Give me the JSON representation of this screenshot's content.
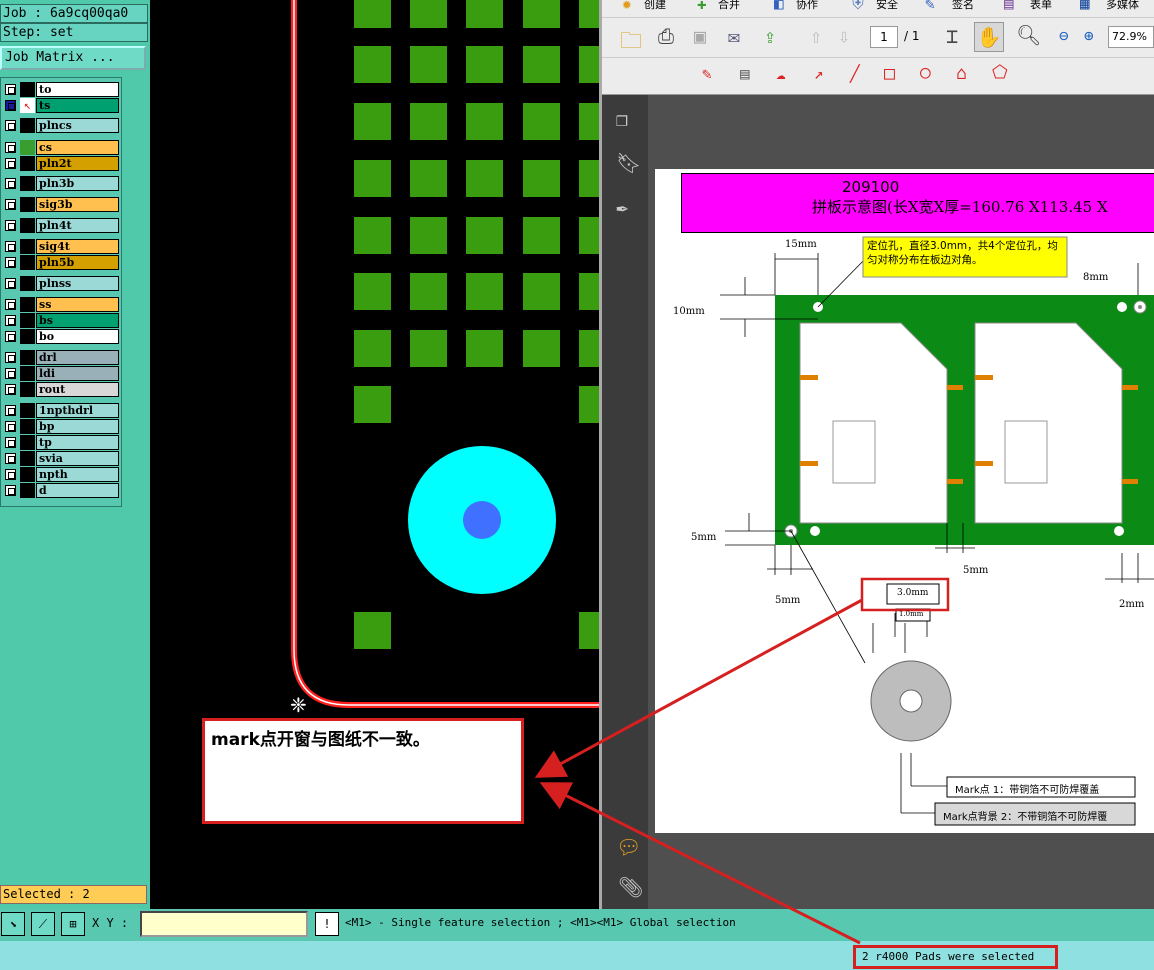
{
  "left_panel": {
    "job": "Job : 6a9cq00qa0",
    "step": "Step: set",
    "job_matrix_label": "Job Matrix ...",
    "layers": [
      {
        "name": "to",
        "color": "#ffffff"
      },
      {
        "name": "ts",
        "color": "#00a070"
      },
      {
        "name": "plncs",
        "color": "#9ad9d5"
      },
      {
        "name": "cs",
        "color": "#ffc050"
      },
      {
        "name": "pln2t",
        "color": "#d4a000"
      },
      {
        "name": "pln3b",
        "color": "#9ad9d5"
      },
      {
        "name": "sig3b",
        "color": "#ffc050"
      },
      {
        "name": "pln4t",
        "color": "#9ad9d5"
      },
      {
        "name": "sig4t",
        "color": "#ffc050"
      },
      {
        "name": "pln5b",
        "color": "#d4a000"
      },
      {
        "name": "plnss",
        "color": "#9ad9d5"
      },
      {
        "name": "ss",
        "color": "#ffc050"
      },
      {
        "name": "bs",
        "color": "#00a070"
      },
      {
        "name": "bo",
        "color": "#ffffff"
      },
      {
        "name": "drl",
        "color": "#9ab0b8"
      },
      {
        "name": "ldi",
        "color": "#9ab0b8"
      },
      {
        "name": "rout",
        "color": "#d8d8d8"
      },
      {
        "name": "1npthdrl",
        "color": "#9ad9d5"
      },
      {
        "name": "bp",
        "color": "#9ad9d5"
      },
      {
        "name": "tp",
        "color": "#9ad9d5"
      },
      {
        "name": "svia",
        "color": "#9ad9d5"
      },
      {
        "name": "npth",
        "color": "#9ad9d5"
      },
      {
        "name": "d",
        "color": "#9ad9d5"
      }
    ],
    "selected": "Selected : 2"
  },
  "canvas": {
    "annotation": "mark点开窗与图纸不一致。"
  },
  "bottom": {
    "xy_label": "X Y :",
    "warn_label": "!",
    "message": "<M1> - Single feature selection ; <M1><M1> Global selection",
    "status": "2 r4000 Pads were selected"
  },
  "pdf": {
    "toolbar_top": [
      "创建",
      "合并",
      "协作",
      "安全",
      "签名",
      "表单",
      "多媒体"
    ],
    "page_input": "1",
    "page_total": "/ 1",
    "zoom": "72.9%",
    "doc_title_line1": "209100",
    "doc_title_line2": "拼板示意图(长X宽X厚=160.76 X113.45 X",
    "callout_text": "定位孔，直径3.0mm，共4个定位孔，均匀对称分布在板边对角。",
    "dims": {
      "d15": "15mm",
      "d10": "10mm",
      "d8": "8mm",
      "d5a": "5mm",
      "d5b": "5mm",
      "d5c": "5mm",
      "d2": "2mm",
      "d30": "3.0mm",
      "d10b": "1.0mm"
    },
    "mark1": "Mark点 1：带铜箔不可防焊覆盖",
    "mark2": "Mark点背景 2：不带铜箔不可防焊覆"
  }
}
